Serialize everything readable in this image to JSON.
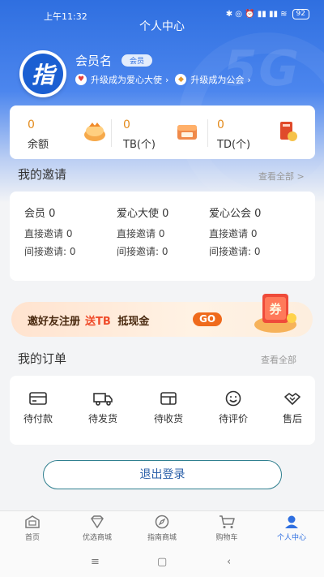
{
  "status_bar": {
    "time": "上午11:32",
    "battery": "92",
    "indicators": "✱ ◎ ⏰ ▮▮ ▮▮ ≋"
  },
  "header": {
    "title": "个人中心",
    "deco_text": "5G"
  },
  "profile": {
    "logo_char": "指",
    "member_name": "会员名",
    "member_badge": "会员",
    "upgrade_ambassador": "升级成为爱心大使",
    "upgrade_guild": "升级成为公会"
  },
  "wallet": [
    {
      "value": "0",
      "label": "余额",
      "icon": "balance-icon"
    },
    {
      "value": "0",
      "label": "TB(个)",
      "icon": "tb-icon"
    },
    {
      "value": "0",
      "label": "TD(个)",
      "icon": "td-icon"
    }
  ],
  "invites": {
    "title": "我的邀请",
    "view_all": "查看全部 >",
    "columns": [
      {
        "main": "会员 0",
        "direct": "直接邀请 0",
        "indirect": "间接邀请: 0"
      },
      {
        "main": "爱心大使 0",
        "direct": "直接邀请 0",
        "indirect": "间接邀请: 0"
      },
      {
        "main": "爱心公会 0",
        "direct": "直接邀请 0",
        "indirect": "间接邀请: 0"
      }
    ]
  },
  "banner": {
    "text": "邀好友注册",
    "highlight": "送TB",
    "text2": "抵现金",
    "go": "GO",
    "coupon_char": "券"
  },
  "orders": {
    "title": "我的订单",
    "view_all": "查看全部",
    "items": [
      {
        "label": "待付款",
        "icon": "card-icon"
      },
      {
        "label": "待发货",
        "icon": "truck-icon"
      },
      {
        "label": "待收货",
        "icon": "box-icon"
      },
      {
        "label": "待评价",
        "icon": "smile-icon"
      },
      {
        "label": "售后",
        "icon": "handshake-icon"
      }
    ]
  },
  "logout": "退出登录",
  "tabbar": [
    {
      "label": "首页",
      "icon": "home-icon"
    },
    {
      "label": "优选商城",
      "icon": "diamond-icon"
    },
    {
      "label": "指南商城",
      "icon": "compass-icon"
    },
    {
      "label": "购物车",
      "icon": "cart-icon"
    },
    {
      "label": "个人中心",
      "icon": "user-icon",
      "active": true
    }
  ],
  "system_nav": {
    "menu": "≡",
    "home": "▢",
    "back": "‹"
  },
  "colors": {
    "brand": "#2f6fe0",
    "accent": "#e38b1c",
    "go": "#ef6a1c"
  }
}
